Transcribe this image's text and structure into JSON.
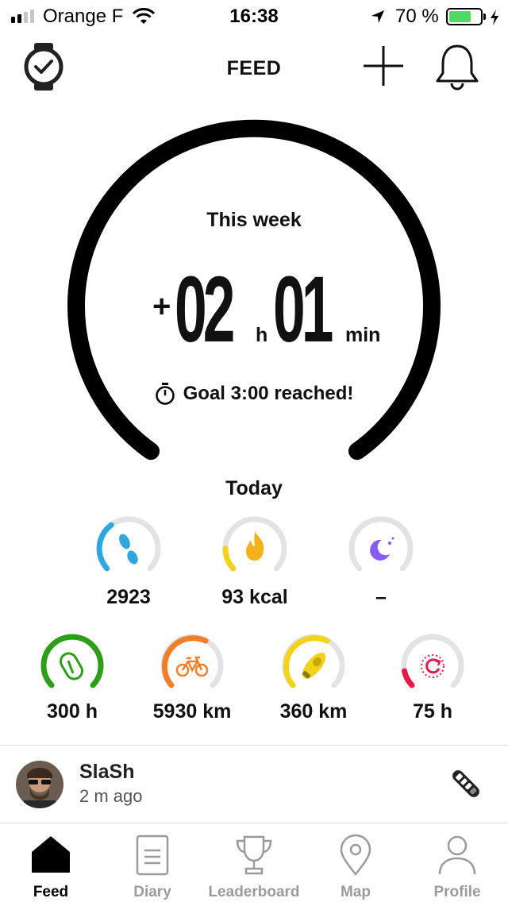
{
  "status_bar": {
    "carrier": "Orange F",
    "time": "16:38",
    "battery_percent": "70 %"
  },
  "header": {
    "title": "FEED"
  },
  "weekly": {
    "label": "This week",
    "prefix": "+",
    "hours": "02",
    "hours_unit": "h",
    "minutes": "01",
    "minutes_unit": "min",
    "goal_text": "Goal 3:00 reached!"
  },
  "today": {
    "label": "Today",
    "metrics": [
      {
        "name": "steps",
        "value": "2923",
        "icon": "footsteps-icon",
        "color": "#2ea6e0"
      },
      {
        "name": "calories",
        "value": "93 kcal",
        "icon": "flame-icon",
        "color": "#f2d21b"
      },
      {
        "name": "sleep",
        "value": "–",
        "icon": "moon-icon",
        "color": "#8a5cf6"
      }
    ]
  },
  "totals": [
    {
      "name": "climbing",
      "value": "300 h",
      "icon": "carabiner-icon",
      "color": "#2e9e1a"
    },
    {
      "name": "cycling",
      "value": "5930 km",
      "icon": "bike-icon",
      "color": "#f07f2a"
    },
    {
      "name": "running",
      "value": "360 km",
      "icon": "shoe-icon",
      "color": "#f2d21b"
    },
    {
      "name": "other",
      "value": "75 h",
      "icon": "activity-icon",
      "color": "#e8194a"
    }
  ],
  "feed": {
    "user_name": "SlaSh",
    "time_ago": "2 m ago",
    "activity_icon": "shoe-icon"
  },
  "tabs": [
    {
      "label": "Feed",
      "icon": "home-icon",
      "active": true
    },
    {
      "label": "Diary",
      "icon": "diary-icon",
      "active": false
    },
    {
      "label": "Leaderboard",
      "icon": "trophy-icon",
      "active": false
    },
    {
      "label": "Map",
      "icon": "map-pin-icon",
      "active": false
    },
    {
      "label": "Profile",
      "icon": "profile-icon",
      "active": false
    }
  ]
}
